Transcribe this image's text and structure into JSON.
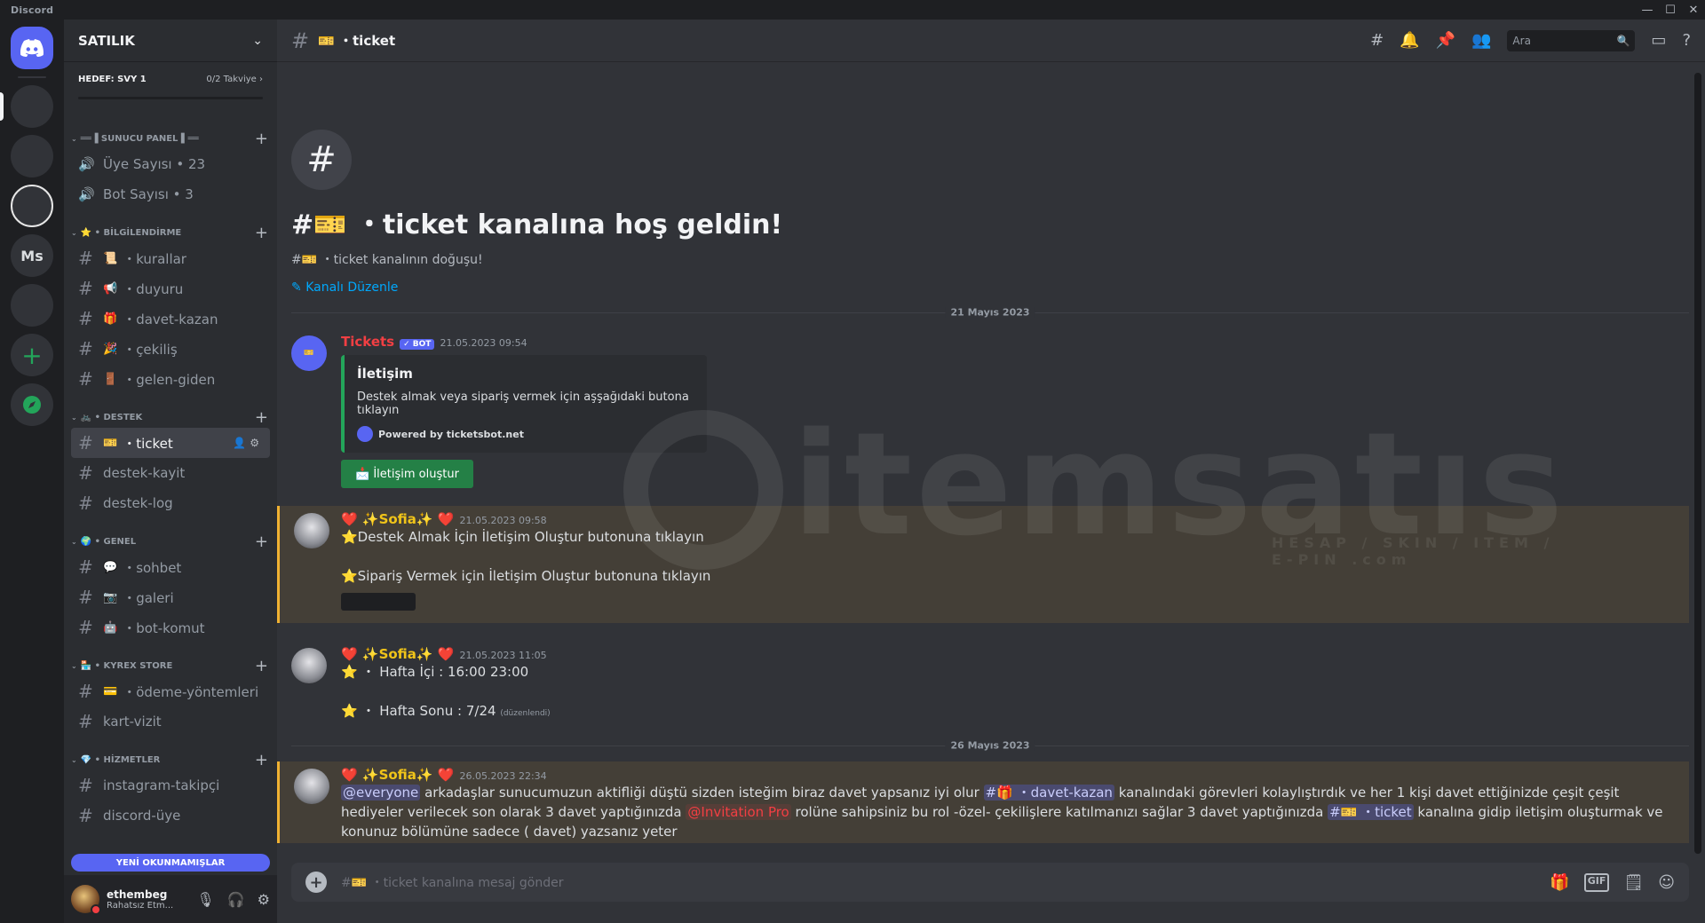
{
  "app": {
    "title": "Discord",
    "window_controls": [
      "—",
      "☐",
      "✕"
    ]
  },
  "rail": {
    "servers": [
      {
        "label": "",
        "icon": "discord-logo-icon"
      },
      {
        "label": "",
        "icon": "server-avatar-1"
      },
      {
        "label": "",
        "icon": "server-avatar-2"
      },
      {
        "label": "",
        "icon": "server-avatar-3"
      },
      {
        "label": "Ms",
        "icon": "server-initials"
      },
      {
        "label": "",
        "icon": "server-avatar-4"
      }
    ],
    "add_label": "+",
    "explore_label": "🧭"
  },
  "guild": {
    "name": "SATILIK",
    "boost_goal": "HEDEF: SVY 1",
    "boost_count": "0/2 Takviye",
    "boost_progress": 0
  },
  "categories": [
    {
      "name": "══▐ SUNUCU PANEL ▌══",
      "channels": [
        {
          "type": "voice",
          "label": "Üye Sayısı • 23"
        },
        {
          "type": "voice",
          "label": "Bot Sayısı • 3"
        }
      ]
    },
    {
      "name": "⭐ • BİLGİLENDİRME",
      "channels": [
        {
          "type": "text",
          "emoji": "📜",
          "label": "・kurallar"
        },
        {
          "type": "text",
          "emoji": "📢",
          "label": "・duyuru"
        },
        {
          "type": "text",
          "emoji": "🎁",
          "label": "・davet-kazan"
        },
        {
          "type": "text",
          "emoji": "🎉",
          "label": "・çekiliş"
        },
        {
          "type": "text",
          "emoji": "🚪",
          "label": "・gelen-giden"
        }
      ]
    },
    {
      "name": "🚲 • DESTEK",
      "channels": [
        {
          "type": "text",
          "emoji": "🎫",
          "label": "・ticket",
          "active": true
        },
        {
          "type": "text",
          "emoji": "",
          "label": "destek-kayit"
        },
        {
          "type": "text",
          "emoji": "",
          "label": "destek-log"
        }
      ]
    },
    {
      "name": "🌍 • GENEL",
      "channels": [
        {
          "type": "text",
          "emoji": "💬",
          "label": "・sohbet"
        },
        {
          "type": "text",
          "emoji": "📷",
          "label": "・galeri"
        },
        {
          "type": "text",
          "emoji": "🤖",
          "label": "・bot-komut"
        }
      ]
    },
    {
      "name": "🏪 • KYREX STORE",
      "channels": [
        {
          "type": "text",
          "emoji": "💳",
          "label": "・ödeme-yöntemleri"
        },
        {
          "type": "text",
          "emoji": "",
          "label": "kart-vizit"
        }
      ]
    },
    {
      "name": "💎 • HİZMETLER",
      "channels": [
        {
          "type": "text",
          "emoji": "",
          "label": "instagram-takipçi"
        },
        {
          "type": "text",
          "emoji": "",
          "label": "discord-üye"
        }
      ]
    }
  ],
  "unread_pill": "YENİ OKUNMAMIŞLAR",
  "user": {
    "name": "ethembeg",
    "status": "Rahatsız Etm..."
  },
  "topbar": {
    "channel": "🎫 ・ticket",
    "search_placeholder": "Ara"
  },
  "welcome": {
    "title": "#🎫 ・ticket kanalına hoş geldin!",
    "subtitle": "#🎫 ・ticket kanalının doğuşu!",
    "edit": "Kanalı Düzenle"
  },
  "dates": [
    "21 Mayıs 2023",
    "26 Mayıs 2023"
  ],
  "messages": [
    {
      "author": "Tickets",
      "bot_badge": "✓ BOT",
      "time": "21.05.2023 09:54",
      "embed_title": "İletişim",
      "embed_desc": "Destek almak veya sipariş vermek için aşşağıdaki butona tıklayın",
      "embed_footer": "Powered by ticketsbot.net",
      "button": "📩 İletişim oluştur"
    },
    {
      "author": "❤️ ✨Sofia✨ ❤️",
      "time": "21.05.2023 09:58",
      "lines": [
        "⭐Destek Almak İçin İletişim Oluştur butonuna tıklayın",
        "⭐Sipariş Vermek için İletişim Oluştur butonuna tıklayın"
      ]
    },
    {
      "author": "❤️ ✨Sofia✨ ❤️",
      "time": "21.05.2023 11:05",
      "lines": [
        "⭐ ・ Hafta İçi : 16:00 23:00",
        "⭐ ・ Hafta Sonu : 7/24"
      ],
      "edited": "(düzenlendi)"
    },
    {
      "author": "❤️ ✨Sofia✨ ❤️",
      "time": "26.05.2023 22:34",
      "mention": "@everyone",
      "p1": " arkadaşlar sunucumuzun aktifliği düştü sizden isteğim biraz davet yapsanız iyi olur ",
      "chip1": "#🎁 ・davet-kazan",
      "p2": "  kanalındaki görevleri kolaylıştırdık ve her 1 kişi davet ettiğinizde çeşit çeşit hediyeler verilecek son olarak 3 davet yaptığınızda ",
      "role": "@Invitation Pro",
      "p3": " rolüne sahipsiniz bu rol -özel- çekilişlere katılmanızı sağlar 3 davet yaptığınızda ",
      "chip2": "#🎫 ・ticket",
      "p4": " kanalına gidip iletişim oluşturmak ve konunuz bölümüne sadece ( davet) yazsanız yeter"
    }
  ],
  "composer": {
    "placeholder": "#🎫 ・ticket kanalına mesaj gönder",
    "gif": "GIF"
  },
  "watermark": {
    "text": "itemsatıs",
    "sub": "HESAP / SKIN / ITEM / E-PIN",
    "com": ".com"
  },
  "colors": {
    "blurple": "#5865f2",
    "green": "#248046",
    "gold": "#f0b232",
    "red": "#f23f43"
  }
}
